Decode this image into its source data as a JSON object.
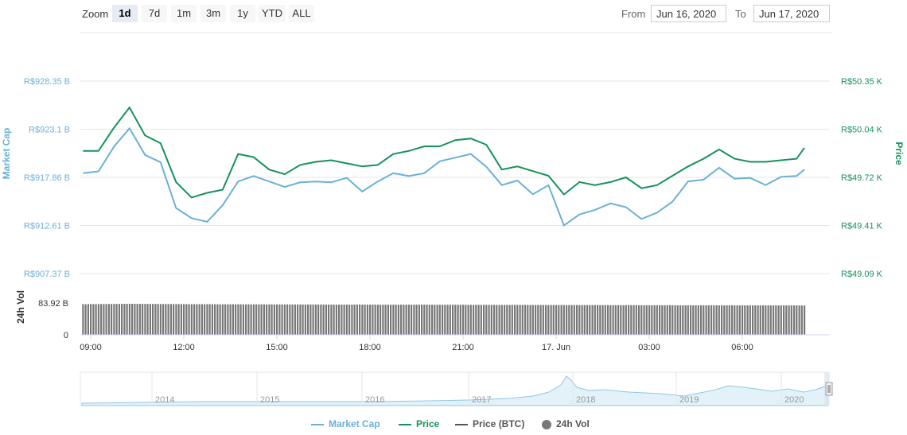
{
  "toolbar": {
    "zoom_label": "Zoom",
    "zoom_buttons": [
      "1d",
      "7d",
      "1m",
      "3m",
      "1y",
      "YTD",
      "ALL"
    ],
    "active_zoom": "1d",
    "from_label": "From",
    "from_value": "Jun 16, 2020",
    "to_label": "To",
    "to_value": "Jun 17, 2020"
  },
  "colors": {
    "market_cap": "#6bb0d6",
    "price": "#16915c",
    "price_btc": "#555555",
    "volume": "#777777"
  },
  "chart_data": {
    "type": "line",
    "y_left_label": "Market Cap",
    "y_right_label": "Price",
    "y_left_ticks": [
      "R$928.35 B",
      "R$923.1 B",
      "R$917.86 B",
      "R$912.61 B",
      "R$907.37 B"
    ],
    "y_left_tick_values": [
      928.35,
      923.1,
      917.86,
      912.61,
      907.37
    ],
    "y_right_ticks": [
      "R$50.35 K",
      "R$50.04 K",
      "R$49.72 K",
      "R$49.41 K",
      "R$49.09 K"
    ],
    "y_right_tick_values": [
      50.35,
      50.04,
      49.72,
      49.41,
      49.09
    ],
    "x_ticks": [
      "09:00",
      "12:00",
      "15:00",
      "18:00",
      "21:00",
      "17. Jun",
      "03:00",
      "06:00"
    ],
    "x_tick_hours": [
      9,
      12,
      15,
      18,
      21,
      24,
      27,
      30
    ],
    "volume_axis_label": "24h Vol",
    "volume_ticks": [
      "83.92 B",
      "0"
    ],
    "volume_tick_values": [
      83.92,
      0
    ],
    "navigator_years": [
      "2014",
      "2015",
      "2016",
      "2017",
      "2018",
      "2019",
      "2020"
    ],
    "series": [
      {
        "name": "Market Cap",
        "unit": "R$ B",
        "x_hours": [
          8.75,
          9.25,
          9.75,
          10.25,
          10.75,
          11.25,
          11.75,
          12.25,
          12.75,
          13.25,
          13.75,
          14.25,
          14.75,
          15.25,
          15.75,
          16.25,
          16.75,
          17.25,
          17.75,
          18.25,
          18.75,
          19.25,
          19.75,
          20.25,
          20.75,
          21.25,
          21.75,
          22.25,
          22.75,
          23.25,
          23.75,
          24.25,
          24.75,
          25.25,
          25.75,
          26.25,
          26.75,
          27.25,
          27.75,
          28.25,
          28.75,
          29.25,
          29.75,
          30.25,
          30.75,
          31.25,
          31.75,
          32.0
        ],
        "values": [
          918.3,
          918.5,
          921.2,
          923.2,
          920.3,
          919.5,
          914.5,
          913.4,
          913.0,
          914.8,
          917.4,
          918.0,
          917.4,
          916.8,
          917.3,
          917.4,
          917.3,
          917.8,
          916.3,
          917.4,
          918.3,
          918.0,
          918.3,
          919.6,
          920.0,
          920.4,
          919.0,
          917.0,
          917.5,
          916.0,
          917.0,
          912.6,
          913.8,
          914.3,
          915.0,
          914.6,
          913.3,
          914.0,
          915.2,
          917.4,
          917.6,
          918.9,
          917.7,
          917.8,
          917.0,
          917.9,
          918.0,
          918.7
        ]
      },
      {
        "name": "Price",
        "unit": "R$ K",
        "x_hours": [
          8.75,
          9.25,
          9.75,
          10.25,
          10.75,
          11.25,
          11.75,
          12.25,
          12.75,
          13.25,
          13.75,
          14.25,
          14.75,
          15.25,
          15.75,
          16.25,
          16.75,
          17.25,
          17.75,
          18.25,
          18.75,
          19.25,
          19.75,
          20.25,
          20.75,
          21.25,
          21.75,
          22.25,
          22.75,
          23.25,
          23.75,
          24.25,
          24.75,
          25.25,
          25.75,
          26.25,
          26.75,
          27.25,
          27.75,
          28.25,
          28.75,
          29.25,
          29.75,
          30.25,
          30.75,
          31.25,
          31.75,
          32.0
        ],
        "values": [
          49.9,
          49.9,
          50.05,
          50.18,
          50.0,
          49.95,
          49.7,
          49.6,
          49.63,
          49.65,
          49.88,
          49.86,
          49.78,
          49.75,
          49.81,
          49.83,
          49.84,
          49.82,
          49.8,
          49.81,
          49.88,
          49.9,
          49.93,
          49.93,
          49.97,
          49.98,
          49.94,
          49.78,
          49.8,
          49.77,
          49.74,
          49.62,
          49.7,
          49.68,
          49.7,
          49.73,
          49.66,
          49.68,
          49.74,
          49.8,
          49.85,
          49.91,
          49.85,
          49.83,
          49.83,
          49.84,
          49.85,
          49.92
        ]
      },
      {
        "name": "Price (BTC)",
        "values": []
      },
      {
        "name": "24h Vol",
        "unit": "R$ B",
        "x_hours": [
          8.75,
          10.25,
          12.0,
          16.0,
          20.0,
          24.0,
          28.0,
          32.0
        ],
        "values": [
          80.7,
          81.8,
          80.9,
          79.9,
          79.4,
          78.6,
          77.9,
          77.5
        ]
      }
    ]
  },
  "legend": {
    "items": [
      "Market Cap",
      "Price",
      "Price (BTC)",
      "24h Vol"
    ]
  }
}
